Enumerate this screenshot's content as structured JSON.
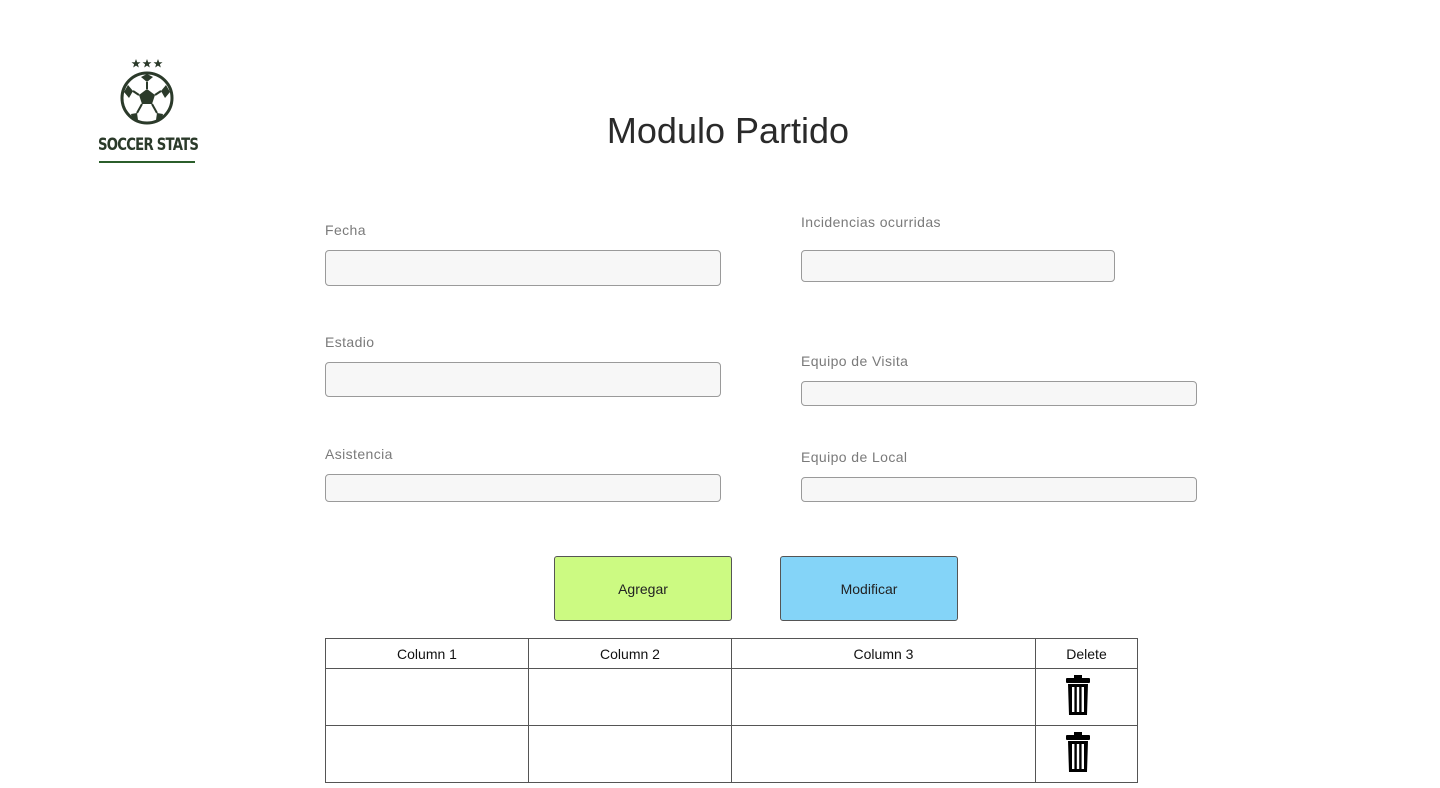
{
  "logo": {
    "text": "SOCCER STATS",
    "icon": "soccer-ball-icon",
    "color": "#2b3a2a"
  },
  "page": {
    "title": "Modulo Partido"
  },
  "form": {
    "fecha": {
      "label": "Fecha",
      "value": "",
      "placeholder": ""
    },
    "incidencias": {
      "label": "Incidencias ocurridas",
      "value": "",
      "placeholder": ""
    },
    "estadio": {
      "label": "Estadio",
      "value": "",
      "placeholder": ""
    },
    "equipo_visita": {
      "label": "Equipo de Visita",
      "value": "",
      "placeholder": ""
    },
    "asistencia": {
      "label": "Asistencia",
      "value": "",
      "placeholder": ""
    },
    "equipo_local": {
      "label": "Equipo de Local",
      "value": "",
      "placeholder": ""
    }
  },
  "buttons": {
    "agregar": {
      "label": "Agregar",
      "color": "#ccfa82"
    },
    "modificar": {
      "label": "Modificar",
      "color": "#84d4f8"
    }
  },
  "table": {
    "columns": [
      "Column 1",
      "Column 2",
      "Column 3",
      "Delete"
    ],
    "rows": [
      {
        "cells": [
          "",
          "",
          ""
        ],
        "delete_icon": "trash-icon"
      },
      {
        "cells": [
          "",
          "",
          ""
        ],
        "delete_icon": "trash-icon"
      }
    ]
  }
}
